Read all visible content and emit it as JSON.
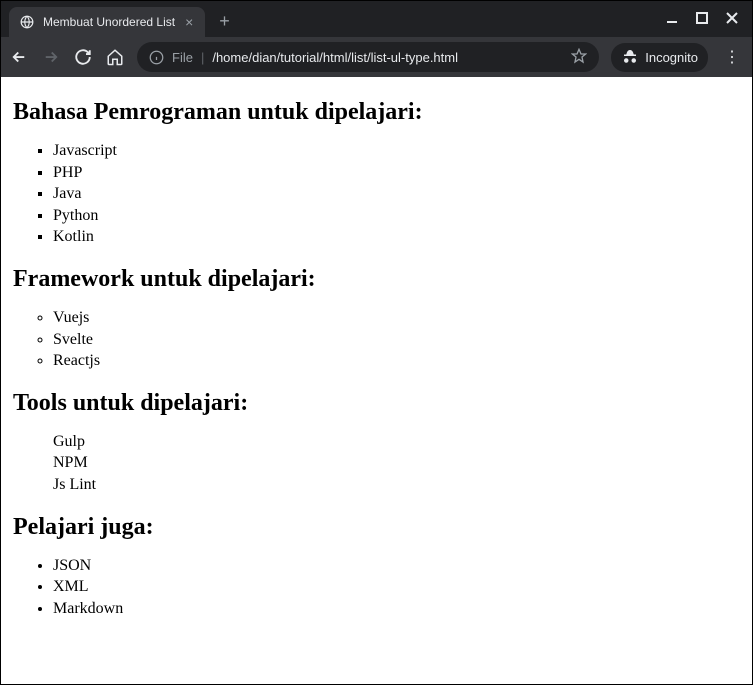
{
  "window": {
    "tab_title": "Membuat Unordered List",
    "url_prefix": "File",
    "url_path": "/home/dian/tutorial/html/list/list-ul-type.html",
    "incognito_label": "Incognito"
  },
  "sections": [
    {
      "heading": "Bahasa Pemrograman untuk dipelajari:",
      "list_style": "square",
      "items": [
        "Javascript",
        "PHP",
        "Java",
        "Python",
        "Kotlin"
      ]
    },
    {
      "heading": "Framework untuk dipelajari:",
      "list_style": "circle",
      "items": [
        "Vuejs",
        "Svelte",
        "Reactjs"
      ]
    },
    {
      "heading": "Tools untuk dipelajari:",
      "list_style": "none",
      "items": [
        "Gulp",
        "NPM",
        "Js Lint"
      ]
    },
    {
      "heading": "Pelajari juga:",
      "list_style": "disc",
      "items": [
        "JSON",
        "XML",
        "Markdown"
      ]
    }
  ]
}
